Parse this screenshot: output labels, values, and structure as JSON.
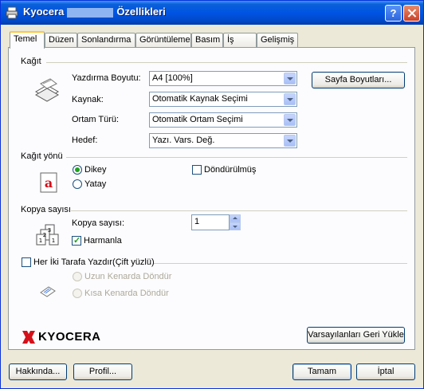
{
  "window": {
    "title_prefix": "Kyocera",
    "title_suffix": "Özellikleri",
    "help_label": "?"
  },
  "tabs": [
    {
      "label": "Temel"
    },
    {
      "label": "Düzen"
    },
    {
      "label": "Sonlandırma"
    },
    {
      "label": "Görüntüleme"
    },
    {
      "label": "Basım"
    },
    {
      "label": "İş"
    },
    {
      "label": "Gelişmiş"
    }
  ],
  "paper": {
    "group_label": "Kağıt",
    "print_size_label": "Yazdırma Boyutu:",
    "print_size_value": "A4  [100%]",
    "source_label": "Kaynak:",
    "source_value": "Otomatik Kaynak Seçimi",
    "media_label": "Ortam Türü:",
    "media_value": "Otomatik Ortam Seçimi",
    "destination_label": "Hedef:",
    "destination_value": "Yazı. Vars. Değ.",
    "page_sizes_button": "Sayfa Boyutları..."
  },
  "orientation": {
    "group_label": "Kağıt yönü",
    "portrait": "Dikey",
    "landscape": "Yatay",
    "rotated": "Döndürülmüş"
  },
  "copies": {
    "group_label": "Kopya sayısı",
    "count_label": "Kopya sayısı:",
    "count_value": "1",
    "collate_label": "Harmanla"
  },
  "duplex": {
    "label": "Her İki Tarafa Yazdır(Çift yüzlü)",
    "long_edge": "Uzun Kenarda Döndür",
    "short_edge": "Kısa Kenarda Döndür"
  },
  "brand": {
    "logo": "KYOCERA",
    "logo_color": "#d4101a"
  },
  "buttons": {
    "defaults": "Varsayılanları Geri Yükle",
    "about": "Hakkında...",
    "profile": "Profil...",
    "ok": "Tamam",
    "cancel": "İptal"
  }
}
